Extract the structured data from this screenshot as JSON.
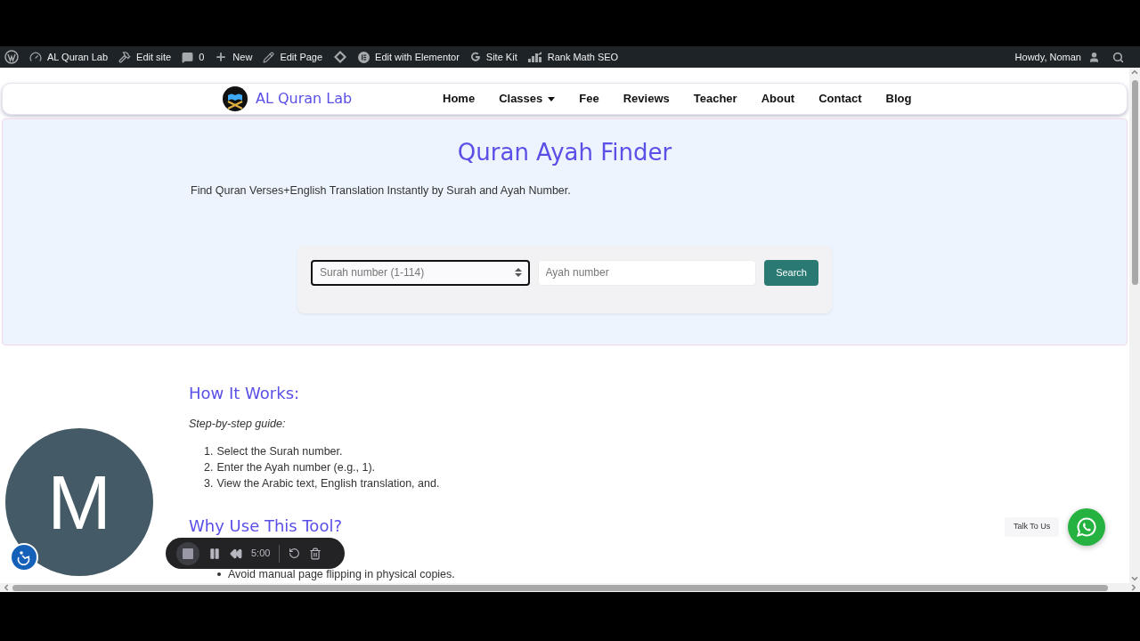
{
  "admin_bar": {
    "items": [
      {
        "label": "AL Quran Lab"
      },
      {
        "label": "Edit site"
      },
      {
        "label": "0"
      },
      {
        "label": "New"
      },
      {
        "label": "Edit Page"
      },
      {
        "label": "Edit with Elementor"
      },
      {
        "label": "Site Kit"
      },
      {
        "label": "Rank Math SEO"
      }
    ],
    "greeting": "Howdy, Noman"
  },
  "nav": {
    "brand": "AL Quran Lab",
    "items": [
      {
        "label": "Home",
        "dropdown": false
      },
      {
        "label": "Classes",
        "dropdown": true
      },
      {
        "label": "Fee",
        "dropdown": false
      },
      {
        "label": "Reviews",
        "dropdown": false
      },
      {
        "label": "Teacher",
        "dropdown": false
      },
      {
        "label": "About",
        "dropdown": false
      },
      {
        "label": "Contact",
        "dropdown": false
      },
      {
        "label": "Blog",
        "dropdown": false
      }
    ]
  },
  "hero": {
    "title": "Quran Ayah Finder",
    "subtitle": "Find Quran Verses+English Translation Instantly by Surah and Ayah Number.",
    "surah_field": {
      "placeholder": "Surah number (1-114)",
      "focused": true
    },
    "ayah_field": {
      "placeholder": "Ayah number",
      "focused": false
    },
    "search_button": "Search"
  },
  "how_it_works": {
    "heading": "How It Works:",
    "intro": "Step-by-step guide:",
    "steps": [
      {
        "number": "1.",
        "text": "Select the Surah number."
      },
      {
        "number": "2.",
        "text": "Enter the Ayah number (e.g., 1)."
      },
      {
        "number": "3.",
        "text": "View the Arabic text, English translation, and."
      }
    ]
  },
  "why_use": {
    "heading": "Why Use This Tool?",
    "bullets": [
      "Avoid manual page flipping in physical copies."
    ]
  },
  "recorder": {
    "avatar_letter": "M",
    "time": "5:00"
  },
  "chat": {
    "label": "Talk To Us"
  }
}
